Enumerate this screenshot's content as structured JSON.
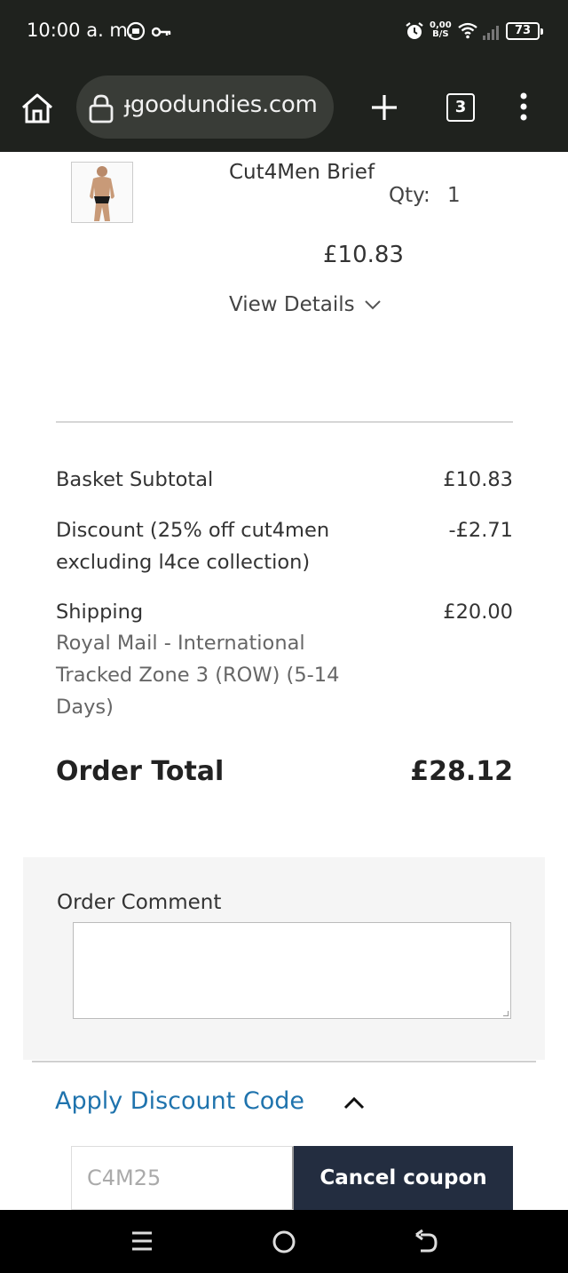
{
  "status_bar": {
    "time": "10:00 a. m.",
    "speed_value": "0,00",
    "speed_unit": "B/S",
    "battery": "73"
  },
  "browser": {
    "url": "ɟgoodundies.com",
    "tab_count": "3"
  },
  "product": {
    "name": "Cut4Men Brief",
    "qty_label": "Qty:",
    "qty_value": "1",
    "price": "£10.83",
    "view_details": "View Details"
  },
  "summary": {
    "subtotal_label": "Basket Subtotal",
    "subtotal_value": "£10.83",
    "discount_label": "Discount (25% off cut4men excluding l4ce collection)",
    "discount_value": "-£2.71",
    "shipping_label": "Shipping",
    "shipping_method": "Royal Mail - International Tracked Zone 3 (ROW) (5-14 Days)",
    "shipping_value": "£20.00",
    "total_label": "Order Total",
    "total_value": "£28.12"
  },
  "comment": {
    "label": "Order Comment",
    "value": ""
  },
  "discount_code": {
    "toggle_label": "Apply Discount Code",
    "code_value": "C4M25",
    "button_label": "Cancel coupon"
  },
  "colors": {
    "chrome_bg": "#1f221e",
    "link_blue": "#1f73ad",
    "button_navy": "#232d40"
  }
}
